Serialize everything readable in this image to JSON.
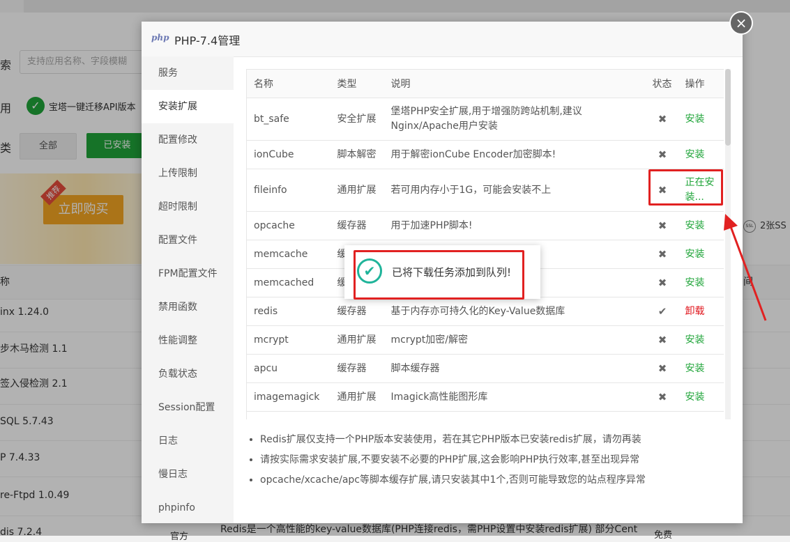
{
  "background": {
    "search_label": "索",
    "search_placeholder": "支持应用名称、字段模糊",
    "app_label": "用",
    "api_text": "宝塔一键迁移API版本",
    "type_label": "类",
    "filter_all": "全部",
    "filter_installed": "已安装",
    "buy_button": "立即购买",
    "ribbon": "推荐",
    "ssl_text": "2张SS",
    "column_time": "间",
    "rows": [
      "inx 1.24.0",
      "步木马检测 1.1",
      "签入侵检测 2.1",
      "SQL 5.7.43",
      "P 7.4.33",
      "re-Ftpd 1.0.49",
      "dis 7.2.4"
    ],
    "bottom_desc": "Redis是一个高性能的key-value数据库(PHP连接redis，需PHP设置中安装redis扩展) 部分Cent",
    "bottom_type": "官方",
    "bottom_price": "免费"
  },
  "dialog": {
    "logo": "php",
    "title": "PHP-7.4管理",
    "close_icon": "×",
    "sidebar": [
      {
        "label": "服务"
      },
      {
        "label": "安装扩展",
        "active": true
      },
      {
        "label": "配置修改"
      },
      {
        "label": "上传限制"
      },
      {
        "label": "超时限制"
      },
      {
        "label": "配置文件"
      },
      {
        "label": "FPM配置文件"
      },
      {
        "label": "禁用函数"
      },
      {
        "label": "性能调整"
      },
      {
        "label": "负载状态"
      },
      {
        "label": "Session配置"
      },
      {
        "label": "日志"
      },
      {
        "label": "慢日志"
      },
      {
        "label": "phpinfo"
      }
    ],
    "table": {
      "headers": {
        "name": "名称",
        "type": "类型",
        "desc": "说明",
        "status": "状态",
        "action": "操作"
      },
      "rows": [
        {
          "name": "bt_safe",
          "type": "安全扩展",
          "desc": "堡塔PHP安全扩展,用于增强防跨站机制,建议Nginx/Apache用户安装",
          "status": "✖",
          "action": "安装"
        },
        {
          "name": "ionCube",
          "type": "脚本解密",
          "desc": "用于解密ionCube Encoder加密脚本!",
          "status": "✖",
          "action": "安装"
        },
        {
          "name": "fileinfo",
          "type": "通用扩展",
          "desc": "若可用内存小于1G，可能会安装不上",
          "status": "✖",
          "action": "正在安装..."
        },
        {
          "name": "opcache",
          "type": "缓存器",
          "desc": "用于加速PHP脚本!",
          "status": "✖",
          "action": "安装"
        },
        {
          "name": "memcache",
          "type": "缓存器",
          "desc": "",
          "status": "✖",
          "action": "安装"
        },
        {
          "name": "memcached",
          "type": "缓存器",
          "desc": "",
          "status": "✖",
          "action": "安装"
        },
        {
          "name": "redis",
          "type": "缓存器",
          "desc": "基于内存亦可持久化的Key-Value数据库",
          "status": "✔",
          "action": "卸载"
        },
        {
          "name": "mcrypt",
          "type": "通用扩展",
          "desc": "mcrypt加密/解密",
          "status": "✖",
          "action": "安装"
        },
        {
          "name": "apcu",
          "type": "缓存器",
          "desc": "脚本缓存器",
          "status": "✖",
          "action": "安装"
        },
        {
          "name": "imagemagick",
          "type": "通用扩展",
          "desc": "Imagick高性能图形库",
          "status": "✖",
          "action": "安装"
        }
      ]
    },
    "notes": [
      "Redis扩展仅支持一个PHP版本安装使用，若在其它PHP版本已安装redis扩展，请勿再装",
      "请按实际需求安装扩展,不要安装不必要的PHP扩展,这会影响PHP执行效率,甚至出现异常",
      "opcache/xcache/apc等脚本缓存扩展,请只安装其中1个,否则可能导致您的站点程序异常"
    ]
  },
  "toast": {
    "icon": "✔",
    "message": "已将下载任务添加到队列!"
  },
  "colors": {
    "accent": "#20a53a",
    "danger": "#e0151c",
    "highlight": "#e12121",
    "toast_icon": "#20b49a"
  }
}
